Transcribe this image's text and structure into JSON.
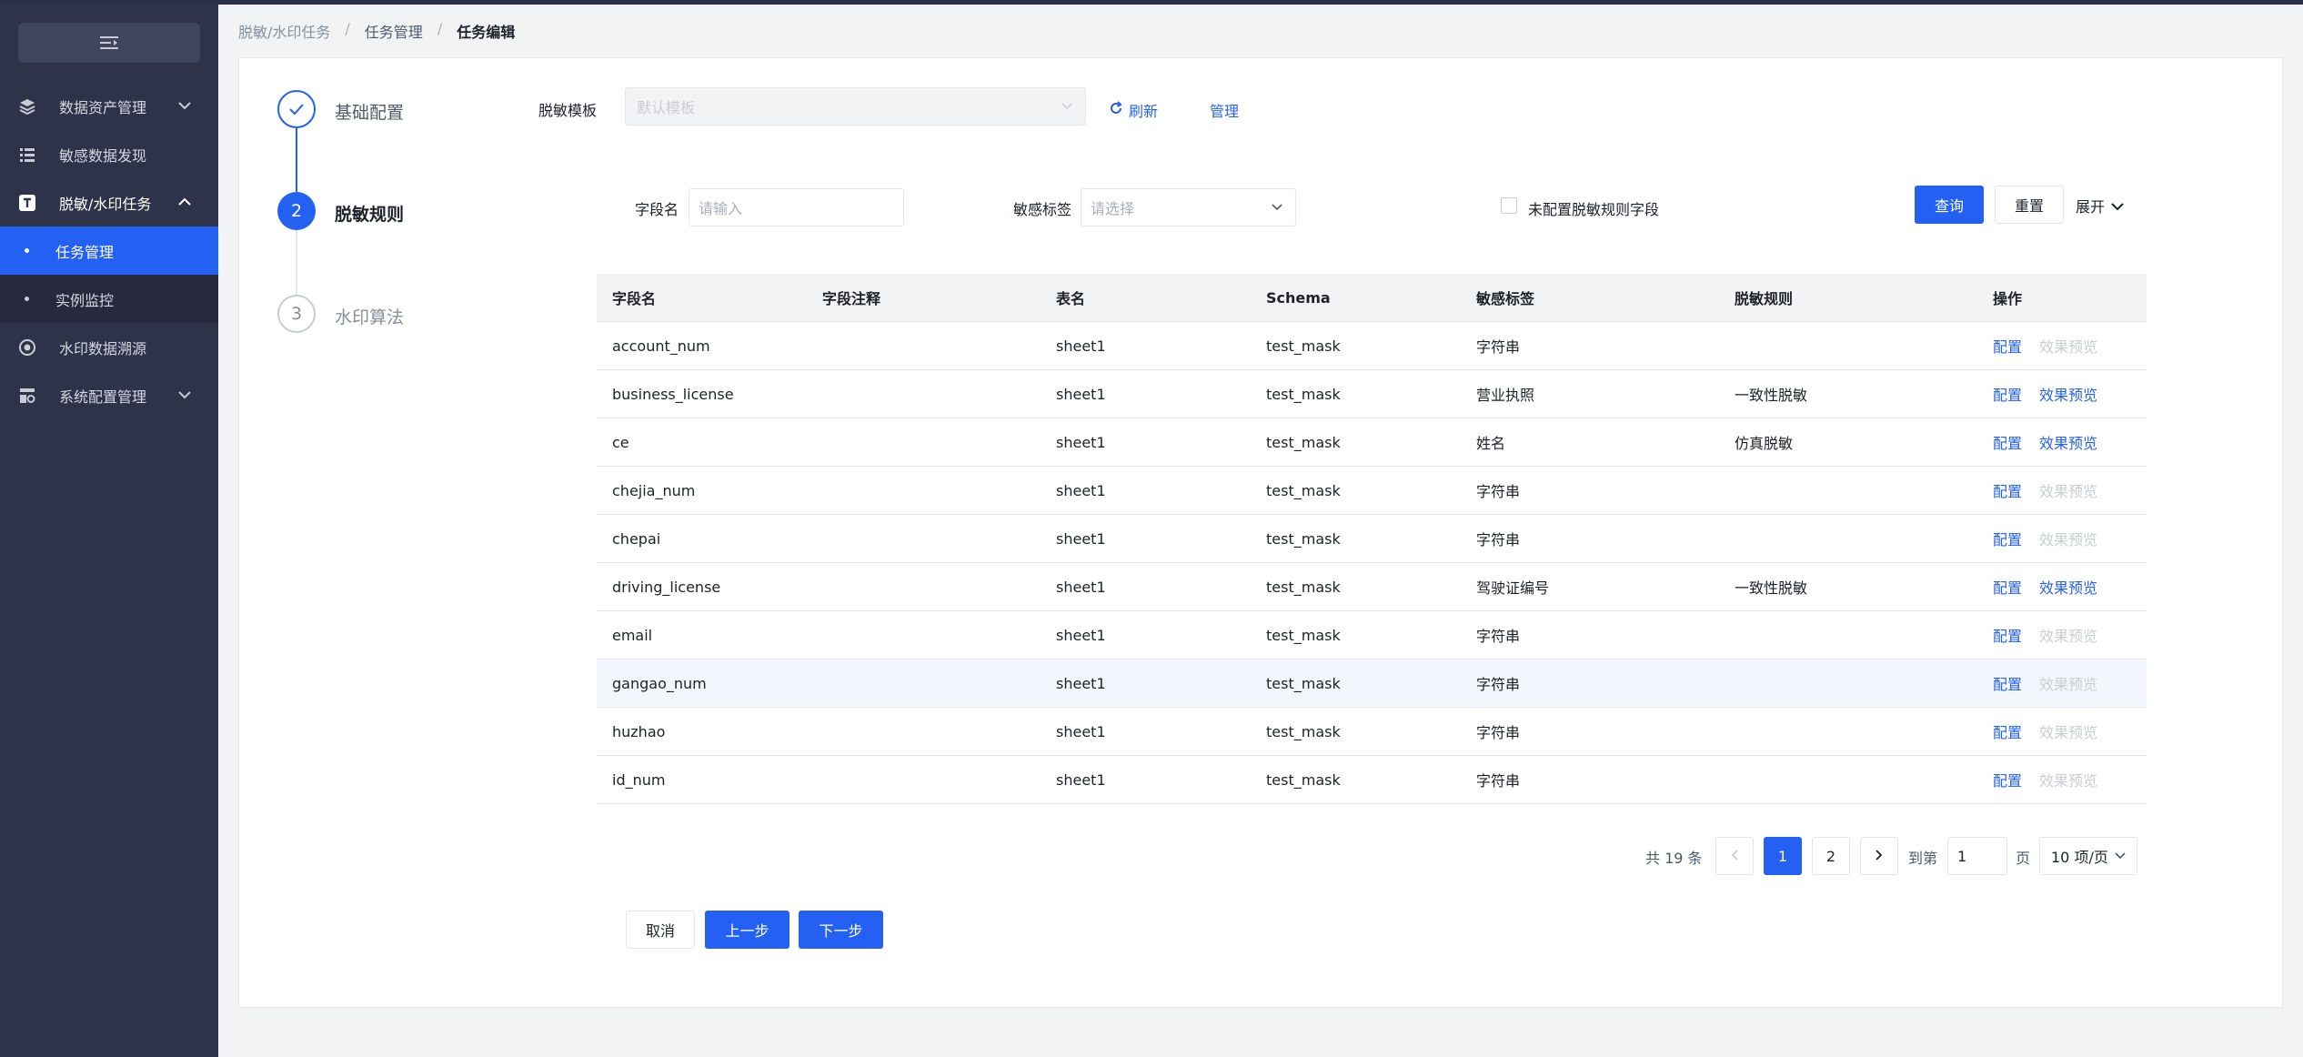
{
  "sidebar": {
    "collapse_icon": "menu-fold-icon",
    "items": [
      {
        "label": "数据资产管理",
        "icon": "layers-icon"
      },
      {
        "label": "敏感数据发现",
        "icon": "list-icon"
      },
      {
        "label": "脱敏/水印任务",
        "icon": "text-t-icon"
      },
      {
        "label": "任务管理"
      },
      {
        "label": "实例监控"
      },
      {
        "label": "水印数据溯源",
        "icon": "target-icon"
      },
      {
        "label": "系统配置管理",
        "icon": "settings-icon"
      }
    ]
  },
  "breadcrumb": [
    "脱敏/水印任务",
    "任务管理",
    "任务编辑"
  ],
  "steps": [
    {
      "label": "基础配置",
      "status": "done"
    },
    {
      "number": "2",
      "label": "脱敏规则",
      "status": "active"
    },
    {
      "number": "3",
      "label": "水印算法",
      "status": "wait"
    }
  ],
  "template": {
    "label": "脱敏模板",
    "placeholder": "默认模板",
    "refresh": "刷新",
    "manage": "管理"
  },
  "filters": {
    "field_label": "字段名",
    "field_placeholder": "请输入",
    "tag_label": "敏感标签",
    "tag_placeholder": "请选择",
    "unconfigured_label": "未配置脱敏规则字段",
    "query": "查询",
    "reset": "重置",
    "expand": "展开"
  },
  "table": {
    "columns": [
      "字段名",
      "字段注释",
      "表名",
      "Schema",
      "敏感标签",
      "脱敏规则",
      "操作"
    ],
    "rows": [
      {
        "field": "account_num",
        "comment": "",
        "table": "sheet1",
        "schema": "test_mask",
        "tag": "字符串",
        "rule": "",
        "config": "配置",
        "preview": "效果预览",
        "preview_enabled": false
      },
      {
        "field": "business_license",
        "comment": "",
        "table": "sheet1",
        "schema": "test_mask",
        "tag": "营业执照",
        "rule": "一致性脱敏",
        "config": "配置",
        "preview": "效果预览",
        "preview_enabled": true
      },
      {
        "field": "ce",
        "comment": "",
        "table": "sheet1",
        "schema": "test_mask",
        "tag": "姓名",
        "rule": "仿真脱敏",
        "config": "配置",
        "preview": "效果预览",
        "preview_enabled": true
      },
      {
        "field": "chejia_num",
        "comment": "",
        "table": "sheet1",
        "schema": "test_mask",
        "tag": "字符串",
        "rule": "",
        "config": "配置",
        "preview": "效果预览",
        "preview_enabled": false
      },
      {
        "field": "chepai",
        "comment": "",
        "table": "sheet1",
        "schema": "test_mask",
        "tag": "字符串",
        "rule": "",
        "config": "配置",
        "preview": "效果预览",
        "preview_enabled": false
      },
      {
        "field": "driving_license",
        "comment": "",
        "table": "sheet1",
        "schema": "test_mask",
        "tag": "驾驶证编号",
        "rule": "一致性脱敏",
        "config": "配置",
        "preview": "效果预览",
        "preview_enabled": true
      },
      {
        "field": "email",
        "comment": "",
        "table": "sheet1",
        "schema": "test_mask",
        "tag": "字符串",
        "rule": "",
        "config": "配置",
        "preview": "效果预览",
        "preview_enabled": false
      },
      {
        "field": "gangao_num",
        "comment": "",
        "table": "sheet1",
        "schema": "test_mask",
        "tag": "字符串",
        "rule": "",
        "config": "配置",
        "preview": "效果预览",
        "preview_enabled": false
      },
      {
        "field": "huzhao",
        "comment": "",
        "table": "sheet1",
        "schema": "test_mask",
        "tag": "字符串",
        "rule": "",
        "config": "配置",
        "preview": "效果预览",
        "preview_enabled": false
      },
      {
        "field": "id_num",
        "comment": "",
        "table": "sheet1",
        "schema": "test_mask",
        "tag": "字符串",
        "rule": "",
        "config": "配置",
        "preview": "效果预览",
        "preview_enabled": false
      }
    ]
  },
  "pagination": {
    "total": "共 19 条",
    "pages": [
      "1",
      "2"
    ],
    "goto_label": "到第",
    "goto_value": "1",
    "page_unit": "页",
    "page_size": "10 项/页"
  },
  "footer": {
    "cancel": "取消",
    "prev": "上一步",
    "next": "下一步"
  }
}
